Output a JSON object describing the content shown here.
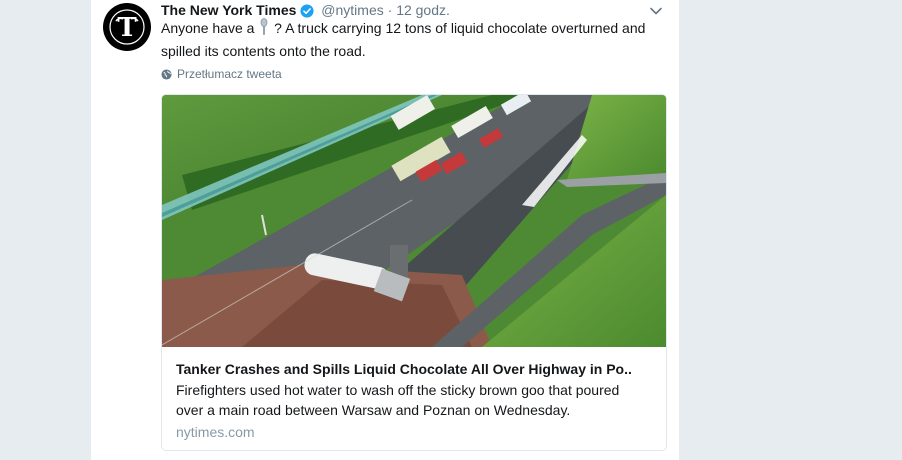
{
  "tweet": {
    "author_name": "The New York Times",
    "author_handle": "@nytimes",
    "separator": "·",
    "timestamp": "12 godz.",
    "text_before_emoji": "Anyone have a ",
    "text_after_emoji": " ? A truck carrying 12 tons of liquid chocolate overturned and spilled its contents onto the road.",
    "emoji_icon": "spoon-icon",
    "translate_label": "Przetłumacz tweeta",
    "verified_color": "#1da1f2"
  },
  "link_card": {
    "title": "Tanker Crashes and Spills Liquid Chocolate All Over Highway in Po..",
    "description": "Firefighters used hot water to wash off the sticky brown goo that poured over a main road between Warsaw and Poznan on Wednesday.",
    "domain": "nytimes.com"
  }
}
